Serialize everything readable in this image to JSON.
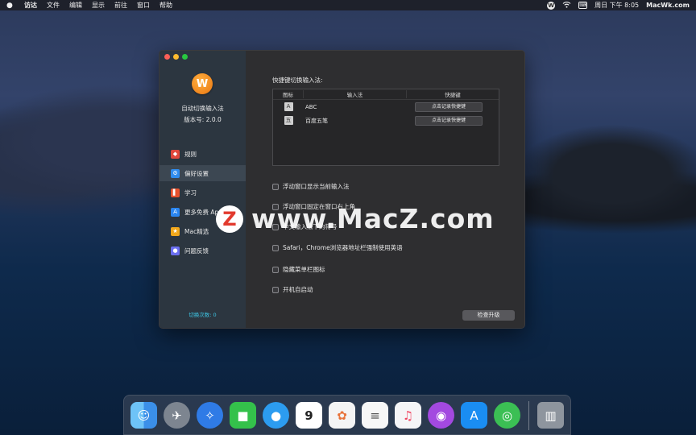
{
  "menubar": {
    "app": "访达",
    "items": [
      "文件",
      "编辑",
      "显示",
      "前往",
      "窗口",
      "帮助"
    ],
    "status_icon_w": "W",
    "clock": "周日 下午 8:05",
    "site": "MacWk.com"
  },
  "app": {
    "logo_glyph": "W",
    "name": "自动切换输入法",
    "version": "版本号: 2.0.0",
    "switch_count": "切换次数: 0"
  },
  "nav": [
    {
      "label": "规则",
      "icon": "rules-icon",
      "color": "#e0483c",
      "glyph": "◆"
    },
    {
      "label": "偏好设置",
      "icon": "gear-icon",
      "color": "#2f8df0",
      "glyph": "⚙"
    },
    {
      "label": "学习",
      "icon": "book-icon",
      "color": "#e8522d",
      "glyph": "▌"
    },
    {
      "label": "更多免费 App",
      "icon": "appstore-icon",
      "color": "#2a86f0",
      "glyph": "A"
    },
    {
      "label": "Mac精选",
      "icon": "star-icon",
      "color": "#f2a81c",
      "glyph": "★"
    },
    {
      "label": "问题反馈",
      "icon": "people-icon",
      "color": "#6b6ff0",
      "glyph": "●"
    }
  ],
  "main": {
    "section_title": "快捷键切换输入法:",
    "table_headers": {
      "icon": "图标",
      "ime": "输入法",
      "shortcut": "快捷键"
    },
    "rows": [
      {
        "badge": "A",
        "name": "ABC",
        "button": "点击记录快捷键"
      },
      {
        "badge": "五",
        "name": "百度五笔",
        "button": "点击记录快捷键"
      }
    ],
    "options": [
      "浮动窗口显示当前输入法",
      "浮动窗口固定在窗口右上角",
      "中文输入法下的符号",
      "Safari，Chrome浏览器地址栏强制使用英语",
      "隐藏菜单栏图标",
      "开机自启动"
    ],
    "check_update": "检查升级"
  },
  "watermark": {
    "logo": "Z",
    "text": "www.MacZ.com"
  },
  "dock": [
    {
      "name": "finder-icon",
      "color": "#3b8fe8",
      "glyph": "☺"
    },
    {
      "name": "launchpad-icon",
      "color": "#7d8590",
      "glyph": "✈"
    },
    {
      "name": "safari-icon",
      "color": "#2f7be6",
      "glyph": "✧"
    },
    {
      "name": "facetime-icon",
      "color": "#34c14b",
      "glyph": "■"
    },
    {
      "name": "messages-icon",
      "color": "#2c9cf0",
      "glyph": "●"
    },
    {
      "name": "calendar-icon",
      "color": "#ffffff",
      "glyph": "9"
    },
    {
      "name": "photos-icon",
      "color": "#f4f4f4",
      "glyph": "✿"
    },
    {
      "name": "reminders-icon",
      "color": "#f7f7f7",
      "glyph": "≡"
    },
    {
      "name": "music-icon",
      "color": "#f5f5f7",
      "glyph": "♫"
    },
    {
      "name": "podcasts-icon",
      "color": "#a349e0",
      "glyph": "◉"
    },
    {
      "name": "appstore-icon",
      "color": "#1a8df2",
      "glyph": "A"
    },
    {
      "name": "findmy-icon",
      "color": "#3bbf54",
      "glyph": "◎"
    },
    {
      "name": "trash-icon",
      "color": "#8e959e",
      "glyph": "▥"
    }
  ]
}
